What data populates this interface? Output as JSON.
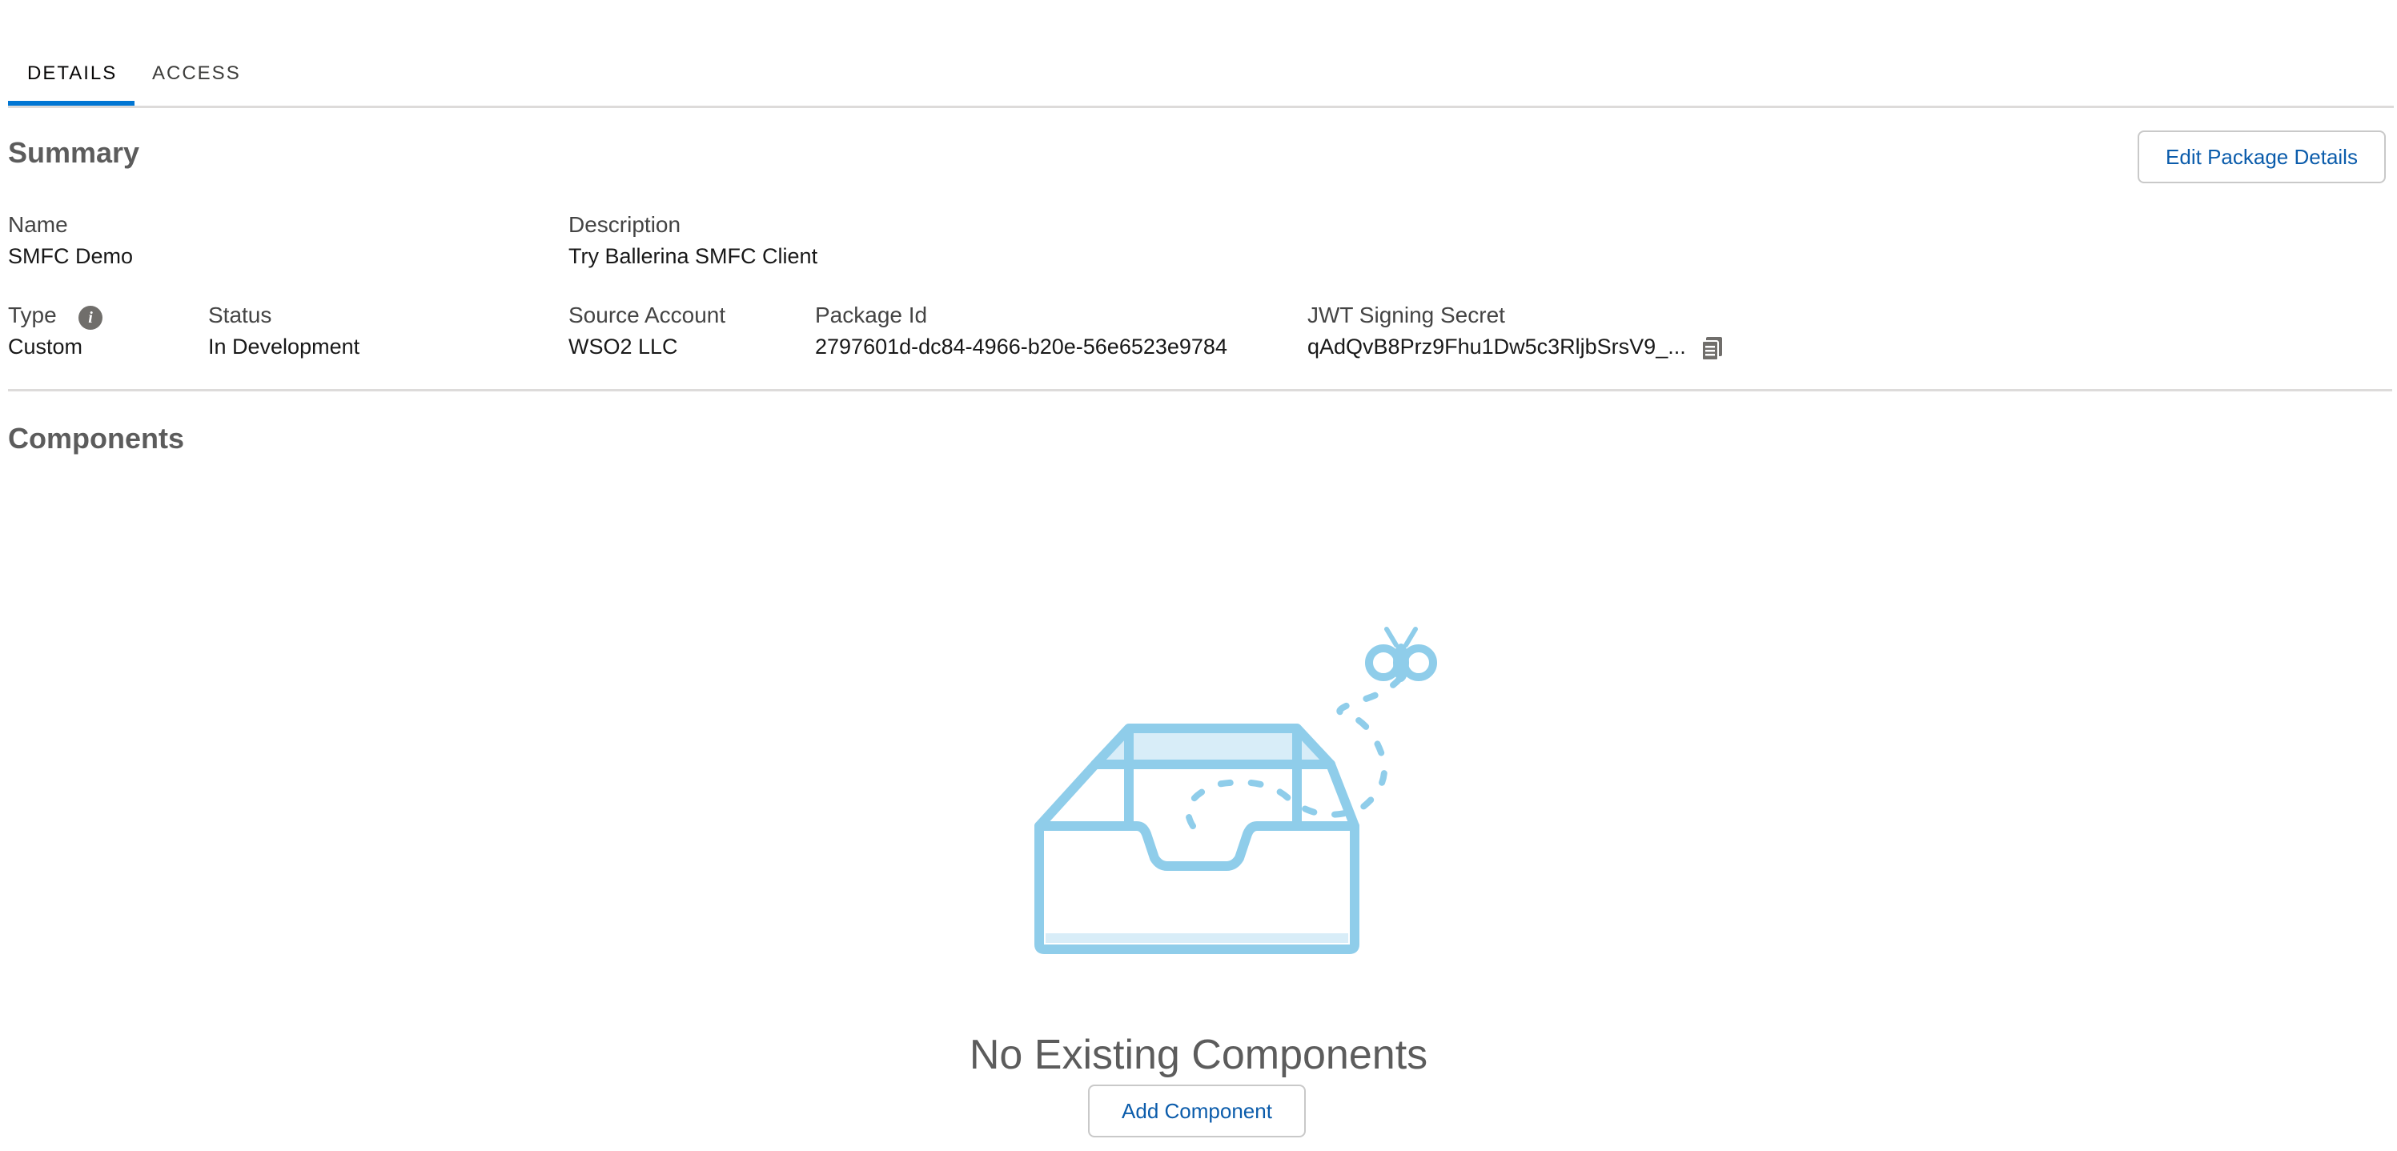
{
  "tabs": [
    {
      "label": "DETAILS",
      "active": true
    },
    {
      "label": "ACCESS",
      "active": false
    }
  ],
  "summary": {
    "heading": "Summary",
    "edit_button": "Edit Package Details",
    "fields": {
      "name": {
        "label": "Name",
        "value": "SMFC Demo"
      },
      "description": {
        "label": "Description",
        "value": "Try Ballerina SMFC Client"
      },
      "type": {
        "label": "Type",
        "value": "Custom",
        "info_icon": "info-icon"
      },
      "status": {
        "label": "Status",
        "value": "In Development"
      },
      "source_account": {
        "label": "Source Account",
        "value": "WSO2 LLC"
      },
      "package_id": {
        "label": "Package Id",
        "value": "2797601d-dc84-4966-b20e-56e6523e9784"
      },
      "jwt_secret": {
        "label": "JWT Signing Secret",
        "value": "qAdQvB8Prz9Fhu1Dw5c3RljbSrsV9_...",
        "copy_icon": "copy-icon"
      }
    }
  },
  "components": {
    "heading": "Components",
    "empty_title": "No Existing Components",
    "add_button": "Add Component",
    "illustration_icon": "empty-inbox-with-bug-icon"
  },
  "colors": {
    "accent": "#0176d3",
    "link": "#0b5cab",
    "illustration": "#8fcdea",
    "illustration_fill": "#d8edf8"
  }
}
